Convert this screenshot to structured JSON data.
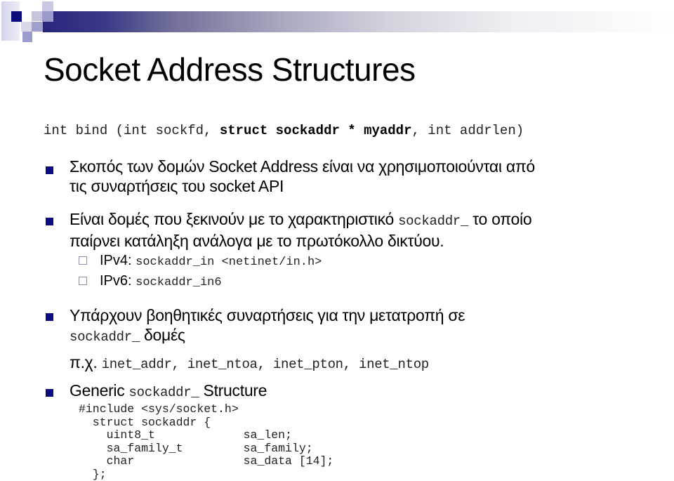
{
  "title": "Socket Address Structures",
  "signature": {
    "part1": "int bind (int sockfd, ",
    "bold": "struct sockaddr * myaddr",
    "part2": ", int addrlen)"
  },
  "bullets": [
    {
      "line1": "Σκοπός των δομών Socket Address είναι να χρησιμοποιούνται από",
      "line2": "τις συναρτήσεις του socket API"
    },
    {
      "line1_text": "Είναι δομές που ξεκινούν με το χαρακτηριστικό ",
      "line1_code": "sockaddr_",
      "line1_tail": " το οποίο",
      "line2": "παίρνει κατάληξη ανάλογα με το πρωτόκολλο δικτύου.",
      "subitems": [
        {
          "label": "IPv4: ",
          "code": "sockaddr_in <netinet/in.h>"
        },
        {
          "label": "IPv6: ",
          "code": "sockaddr_in6"
        }
      ]
    },
    {
      "line1": "Υπάρχουν βοηθητικές συναρτήσεις για την μετατροπή σε",
      "line2_code": "sockaddr_",
      "line2_text": " δομές",
      "example_label": "π.χ. ",
      "example_code": "inet_addr, inet_ntoa, inet_pton, inet_ntop"
    },
    {
      "text": "Generic ",
      "code": "sockaddr_",
      "tail": " Structure"
    }
  ],
  "code_block": {
    "include": "#include <sys/socket.h>",
    "struct_open": "  struct sockaddr {",
    "fields": [
      {
        "type": "uint8_t",
        "name": "sa_len;"
      },
      {
        "type": "sa_family_t",
        "name": "sa_family;"
      },
      {
        "type": "char",
        "name": "sa_data [14];"
      }
    ],
    "struct_close": "  };"
  },
  "colors": {
    "bullet": "#0d0d80",
    "header_bar": "#26267e"
  }
}
